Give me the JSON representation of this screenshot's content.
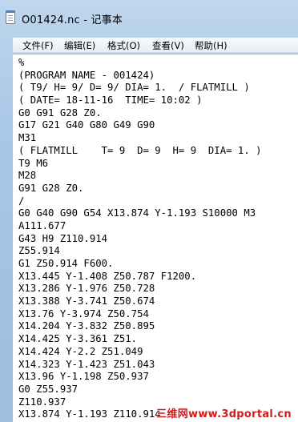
{
  "window": {
    "title": "O01424.nc - 记事本"
  },
  "menu": {
    "items": [
      {
        "label": "文件(F)"
      },
      {
        "label": "编辑(E)"
      },
      {
        "label": "格式(O)"
      },
      {
        "label": "查看(V)"
      },
      {
        "label": "帮助(H)"
      }
    ]
  },
  "editor": {
    "lines": [
      "%",
      "(PROGRAM NAME - 001424)",
      "( T9/ H= 9/ D= 9/ DIA= 1.  / FLATMILL )",
      "( DATE= 18-11-16  TIME= 10:02 )",
      "G0 G91 G28 Z0.",
      "G17 G21 G40 G80 G49 G90",
      "M31",
      "( FLATMILL    T= 9  D= 9  H= 9  DIA= 1. )",
      "T9 M6",
      "M28",
      "G91 G28 Z0.",
      "/",
      "G0 G40 G90 G54 X13.874 Y-1.193 S10000 M3",
      "A111.677",
      "G43 H9 Z110.914",
      "Z55.914",
      "G1 Z50.914 F600.",
      "X13.445 Y-1.408 Z50.787 F1200.",
      "X13.286 Y-1.976 Z50.728",
      "X13.388 Y-3.741 Z50.674",
      "X13.76 Y-3.974 Z50.754",
      "X14.204 Y-3.832 Z50.895",
      "X14.425 Y-3.361 Z51.",
      "X14.424 Y-2.2 Z51.049",
      "X14.323 Y-1.423 Z51.043",
      "X13.96 Y-1.198 Z50.937",
      "G0 Z55.937",
      "Z110.937",
      "X13.874 Y-1.193 Z110.914"
    ]
  },
  "watermark": {
    "text": "三维网www.3dportal.cn"
  }
}
